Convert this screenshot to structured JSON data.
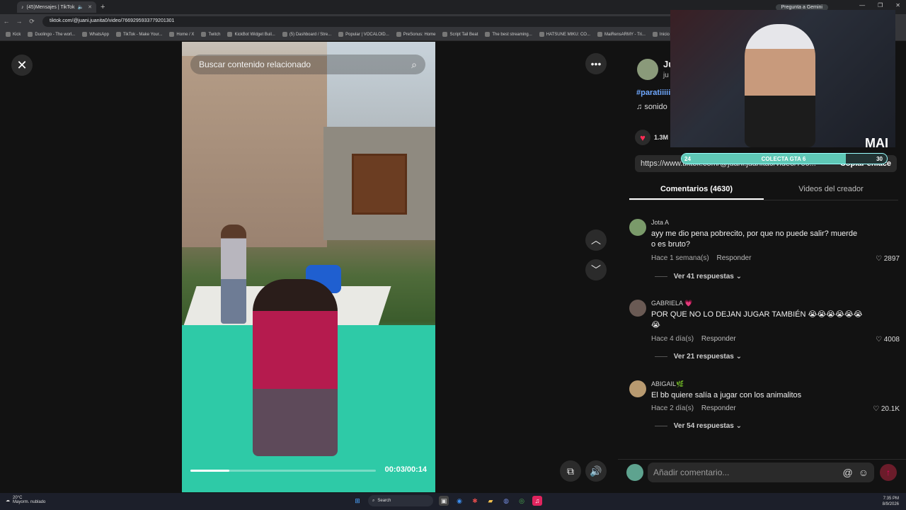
{
  "browser": {
    "tab_title": "(45)Mensajes | TikTok",
    "gemini_label": "Pregunta a Gemini",
    "url": "tiktok.com/@juani.juanita0/video/7669295933779201301",
    "bookmarks": [
      "Kick",
      "Duolingo - The worl...",
      "WhatsApp",
      "TikTok - Make Your...",
      "Home / X",
      "Twitch",
      "KickBot Widget Buil...",
      "(5) Dashboard / Stre...",
      "Popular | VOCALOID...",
      "PreSonus: Home",
      "Script Tail Beat",
      "The best streaming...",
      "HATSUNE MIKU: CO...",
      "MaiRensARMY - Tri...",
      "Inicio"
    ]
  },
  "video": {
    "search_placeholder": "Buscar contenido relacionado",
    "time": "00:03/00:14",
    "progress": 0.21
  },
  "panel": {
    "creator_name": "Ju",
    "creator_handle": "ju",
    "hashtag": "#paratiiiii",
    "sound": "sonido",
    "likes": "1.3M",
    "link": "https://www.tiktok.com/@juani.juanita0/video/766...",
    "copy_label": "Copiar enlace",
    "tabs": {
      "comments": "Comentarios (4630)",
      "creator_videos": "Videos del creador"
    },
    "comments": [
      {
        "user": "Jota A",
        "text": "ayy me dio pena pobrecito, por que no puede salir? muerde o es bruto?",
        "time": "Hace 1 semana(s)",
        "reply": "Responder",
        "likes": "2897",
        "replies": "Ver 41 respuestas"
      },
      {
        "user": "GABRIELA 💗",
        "text": "POR QUE NO LO DEJAN JUGAR TAMBIÉN 😭😭😭😭😭😭😭",
        "time": "Hace 4 día(s)",
        "reply": "Responder",
        "likes": "4008",
        "replies": "Ver 21 respuestas"
      },
      {
        "user": "ABIGAIL🌿",
        "text": "El bb quiere salía a jugar con los animalitos",
        "time": "Hace 2 día(s)",
        "reply": "Responder",
        "likes": "20.1K",
        "replies": "Ver 54 respuestas"
      }
    ],
    "comment_placeholder": "Añadir comentario..."
  },
  "stream_overlay": {
    "tag": "MAI",
    "goal_label": "COLECTA GTA 6",
    "goal_current": "24",
    "goal_target": "30",
    "goal_progress": 0.8
  },
  "taskbar": {
    "temperature": "20°C",
    "weather": "Mayorm. nublado",
    "search_label": "Search",
    "time": "7:35 PM",
    "date": "8/9/2026"
  }
}
